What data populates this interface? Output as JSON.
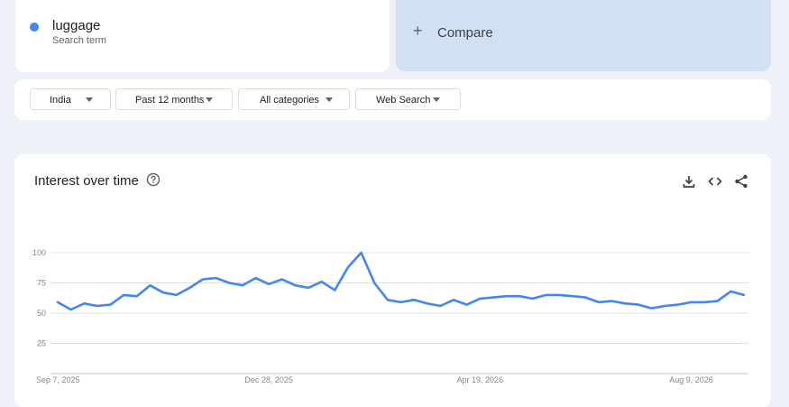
{
  "search_term": {
    "name": "luggage",
    "subtitle": "Search term",
    "color": "#4285f4"
  },
  "compare": {
    "label": "Compare",
    "icon": "plus-icon"
  },
  "filters": [
    {
      "label": "India",
      "icon": "caret-down-icon"
    },
    {
      "label": "Past 12 months",
      "icon": "caret-down-icon"
    },
    {
      "label": "All categories",
      "icon": "caret-down-icon"
    },
    {
      "label": "Web Search",
      "icon": "caret-down-icon"
    }
  ],
  "panel": {
    "title": "Interest over time",
    "icons": [
      "help-icon",
      "download-icon",
      "embed-icon",
      "share-icon"
    ]
  },
  "chart_data": {
    "type": "line",
    "title": "Interest over time",
    "xlabel": "",
    "ylabel": "",
    "ylim": [
      0,
      100
    ],
    "yticks": [
      25,
      50,
      75,
      100
    ],
    "grid": true,
    "xtick_labels": [
      {
        "label": "Sep 7, 2025",
        "index": 0
      },
      {
        "label": "Dec 28, 2025",
        "index": 16
      },
      {
        "label": "Apr 19, 2026",
        "index": 32
      },
      {
        "label": "Aug 9, 2026",
        "index": 48
      }
    ],
    "series": [
      {
        "color": "#4285f4",
        "values": [
          59,
          53,
          58,
          56,
          57,
          65,
          64,
          73,
          67,
          65,
          71,
          78,
          79,
          75,
          73,
          79,
          74,
          78,
          73,
          71,
          76,
          69,
          88,
          100,
          75,
          61,
          59,
          61,
          58,
          56,
          61,
          57,
          62,
          63,
          64,
          64,
          62,
          65,
          65,
          64,
          63,
          59,
          60,
          58,
          57,
          54,
          56,
          57,
          59,
          59,
          60,
          68,
          65
        ]
      }
    ]
  }
}
